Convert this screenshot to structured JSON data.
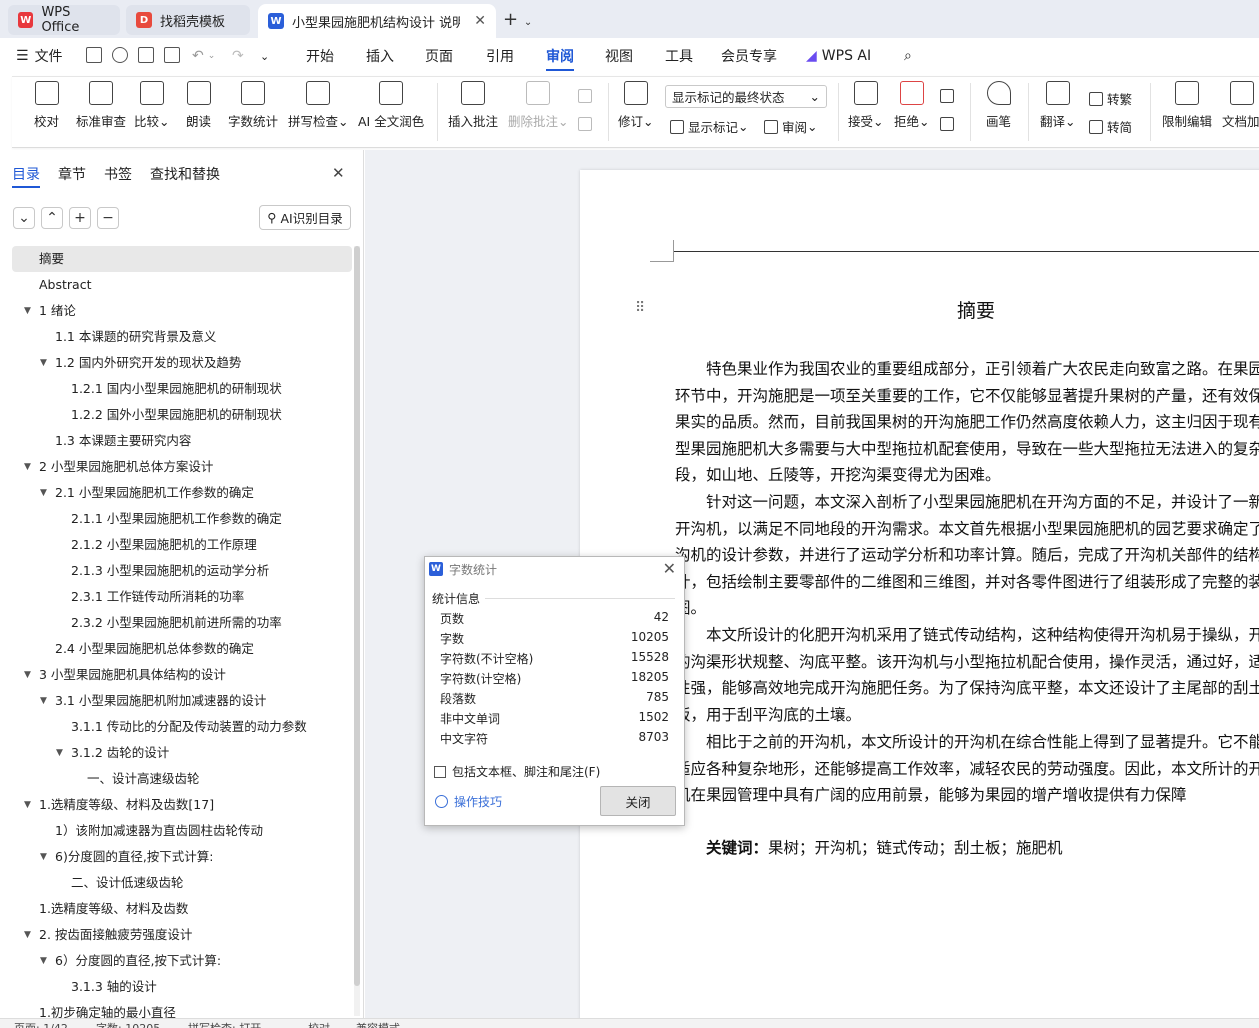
{
  "tabs": {
    "wps": "WPS Office",
    "template": "找稻壳模板",
    "doc": "小型果园施肥机结构设计 说明"
  },
  "menu": {
    "file": "文件",
    "items": [
      "开始",
      "插入",
      "页面",
      "引用",
      "审阅",
      "视图",
      "工具",
      "会员专享"
    ],
    "active": "审阅",
    "wps_ai": "WPS AI"
  },
  "ribbon": {
    "proofread": "校对",
    "standard_review": "标准审查",
    "compare": "比较",
    "read_aloud": "朗读",
    "word_count": "字数统计",
    "spell_check": "拼写检查",
    "ai_polish": "AI 全文润色",
    "insert_comment": "插入批注",
    "delete_comment": "删除批注",
    "track": "修订",
    "show_markup_state": "显示标记的最终状态",
    "show_markup": "显示标记",
    "review": "审阅",
    "accept": "接受",
    "reject": "拒绝",
    "pen": "画笔",
    "translate": "翻译",
    "to_traditional": "转繁",
    "to_simplified": "转简",
    "restrict_edit": "限制编辑",
    "doc_encrypt": "文档加"
  },
  "sidebar": {
    "tabs": [
      "目录",
      "章节",
      "书签",
      "查找和替换"
    ],
    "ai_button": "AI识别目录",
    "toc": [
      {
        "label": "摘要",
        "level": 0,
        "arrow": false,
        "selected": true
      },
      {
        "label": "Abstract",
        "level": 0,
        "arrow": false
      },
      {
        "label": "1 绪论",
        "level": 0,
        "arrow": true
      },
      {
        "label": "1.1 本课题的研究背景及意义",
        "level": 1,
        "arrow": false
      },
      {
        "label": "1.2 国内外研究开发的现状及趋势",
        "level": 1,
        "arrow": true
      },
      {
        "label": "1.2.1 国内小型果园施肥机的研制现状",
        "level": 2,
        "arrow": false
      },
      {
        "label": "1.2.2 国外小型果园施肥机的研制现状",
        "level": 2,
        "arrow": false
      },
      {
        "label": "1.3 本课题主要研究内容",
        "level": 1,
        "arrow": false
      },
      {
        "label": "2 小型果园施肥机总体方案设计",
        "level": 0,
        "arrow": true
      },
      {
        "label": "2.1 小型果园施肥机工作参数的确定",
        "level": 1,
        "arrow": true
      },
      {
        "label": "2.1.1 小型果园施肥机工作参数的确定",
        "level": 2,
        "arrow": false
      },
      {
        "label": "2.1.2 小型果园施肥机的工作原理",
        "level": 2,
        "arrow": false
      },
      {
        "label": "2.1.3 小型果园施肥机的运动学分析",
        "level": 2,
        "arrow": false
      },
      {
        "label": "2.3.1 工作链传动所消耗的功率",
        "level": 2,
        "arrow": false
      },
      {
        "label": "2.3.2 小型果园施肥机前进所需的功率",
        "level": 2,
        "arrow": false
      },
      {
        "label": "2.4 小型果园施肥机总体参数的确定",
        "level": 1,
        "arrow": false
      },
      {
        "label": "3  小型果园施肥机具体结构的设计",
        "level": 0,
        "arrow": true
      },
      {
        "label": "3.1 小型果园施肥机附加减速器的设计",
        "level": 1,
        "arrow": true
      },
      {
        "label": "3.1.1 传动比的分配及传动装置的动力参数",
        "level": 2,
        "arrow": false
      },
      {
        "label": "3.1.2 齿轮的设计",
        "level": 2,
        "arrow": true
      },
      {
        "label": "一、设计高速级齿轮",
        "level": 3,
        "arrow": false
      },
      {
        "label": "1.选精度等级、材料及齿数[17]",
        "level": 0,
        "arrow": true
      },
      {
        "label": "1）该附加减速器为直齿圆柱齿轮传动",
        "level": 1,
        "arrow": false
      },
      {
        "label": "6)分度圆的直径,按下式计算:",
        "level": 1,
        "arrow": true
      },
      {
        "label": "二、设计低速级齿轮",
        "level": 2,
        "arrow": false
      },
      {
        "label": "1.选精度等级、材料及齿数",
        "level": 0,
        "arrow": false
      },
      {
        "label": "2. 按齿面接触疲劳强度设计",
        "level": 0,
        "arrow": true
      },
      {
        "label": "6）分度圆的直径,按下式计算:",
        "level": 1,
        "arrow": true
      },
      {
        "label": "3.1.3 轴的设计",
        "level": 2,
        "arrow": false
      },
      {
        "label": "1.初步确定轴的最小直径",
        "level": 0,
        "arrow": false
      }
    ]
  },
  "document": {
    "title": "摘要",
    "paragraphs": [
      "特色果业作为我国农业的重要组成部分，正引领着广大农民走向致富之路。在果园艺环节中，开沟施肥是一项至关重要的工作，它不仅能够显著提升果树的产量，还有效保证果实的品质。然而，目前我国果树的开沟施肥工作仍然高度依赖人力，这主归因于现有小型果园施肥机大多需要与大中型拖拉机配套使用，导致在一些大型拖拉无法进入的复杂地段，如山地、丘陵等，开挖沟渠变得尤为困难。",
      "针对这一问题，本文深入剖析了小型果园施肥机在开沟方面的不足，并设计了一新型开沟机，以满足不同地段的开沟需求。本文首先根据小型果园施肥机的园艺要求确定了开沟机的设计参数，并进行了运动学分析和功率计算。随后，完成了开沟机关部件的结构设计，包括绘制主要零部件的二维图和三维图，并对各零件图进行了组装形成了完整的装配图。",
      "本文所设计的化肥开沟机采用了链式传动结构，这种结构使得开沟机易于操纵，开出的沟渠形状规整、沟底平整。该开沟机与小型拖拉机配合使用，操作灵活，通过好，适应性强，能够高效地完成开沟施肥任务。为了保持沟底平整，本文还设计了主尾部的刮土板，用于刮平沟底的土壤。",
      "相比于之前的开沟机，本文所设计的开沟机在综合性能上得到了显著提升。它不能够适应各种复杂地形，还能够提高工作效率，减轻农民的劳动强度。因此，本文所计的开沟机在果园管理中具有广阔的应用前景，能够为果园的增产增收提供有力保障"
    ],
    "keywords_label": "关键词：",
    "keywords": "果树；开沟机；链式传动；刮土板；施肥机"
  },
  "dialog": {
    "title": "字数统计",
    "group": "统计信息",
    "stats": [
      {
        "label": "页数",
        "value": "42"
      },
      {
        "label": "字数",
        "value": "10205"
      },
      {
        "label": "字符数(不计空格)",
        "value": "15528"
      },
      {
        "label": "字符数(计空格)",
        "value": "18205"
      },
      {
        "label": "段落数",
        "value": "785"
      },
      {
        "label": "非中文单词",
        "value": "1502"
      },
      {
        "label": "中文字符",
        "value": "8703"
      }
    ],
    "include_label": "包括文本框、脚注和尾注(F)",
    "tips": "操作技巧",
    "close": "关闭"
  },
  "status": {
    "page": "页面: 1/42",
    "words": "字数: 10205",
    "spell": "拼写检查: 打开",
    "proof": "校对",
    "compat": "兼容模式"
  },
  "colors": {
    "accent": "#1f58d6",
    "wps_red": "#e8383d"
  }
}
